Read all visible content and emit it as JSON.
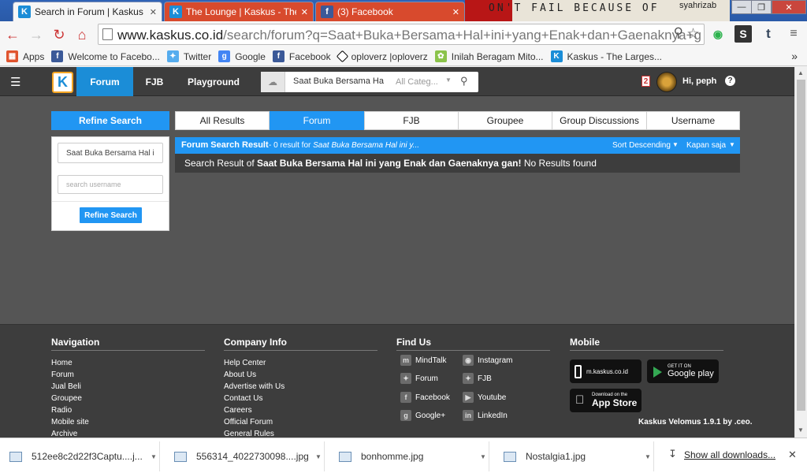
{
  "browser": {
    "tabs": [
      {
        "label": "Search in Forum | Kaskus",
        "close": "✕",
        "fav": "K",
        "fav_color": "#1b8dd7"
      },
      {
        "label": "The Lounge | Kaskus - The",
        "close": "✕",
        "fav": "K",
        "fav_color": "#1b8dd7"
      },
      {
        "label": "(3) Facebook",
        "close": "✕",
        "fav": "f",
        "fav_color": "#3b5998"
      }
    ],
    "wallpaper_text": "ON'T  FAIL  BECAUSE  OF",
    "os_user": "syahrizab",
    "window_buttons": [
      "—",
      "❐",
      "✕"
    ],
    "url_host": "www.kaskus.co.id",
    "url_path": "/search/forum?q=Saat+Buka+Bersama+Hal+ini+yang+Enak+dan+Gaenaknya+g",
    "bookmarks": [
      {
        "label": "Apps",
        "icon": "apps-icon",
        "color": "#e0542e"
      },
      {
        "label": "Welcome to Facebo...",
        "icon": "facebook-icon",
        "color": "#3b5998"
      },
      {
        "label": "Twitter",
        "icon": "twitter-icon",
        "color": "#55acee"
      },
      {
        "label": "Google",
        "icon": "google-icon",
        "color": "#4285f4"
      },
      {
        "label": "Facebook",
        "icon": "facebook-icon",
        "color": "#3b5998"
      },
      {
        "label": "oploverz |oploverz",
        "icon": "oploverz-icon",
        "color": "#ffffff"
      },
      {
        "label": "Inilah Beragam Mito...",
        "icon": "leaf-icon",
        "color": "#8bc34a"
      },
      {
        "label": "Kaskus - The Larges...",
        "icon": "kaskus-icon",
        "color": "#1b8dd7"
      }
    ],
    "bookmarks_more": "»"
  },
  "kaskus": {
    "nav": [
      "Forum",
      "FJB",
      "Playground"
    ],
    "search_query": "Saat Buka Bersama Ha",
    "search_category": "All Categ...",
    "notif_count": "2",
    "greeting": "Hi, peph",
    "help": "?",
    "refine": {
      "title": "Refine Search",
      "keyword_value": "Saat Buka Bersama Hal i",
      "username_placeholder": "search username",
      "button": "Refine Search"
    },
    "result_tabs": [
      "All Results",
      "Forum",
      "FJB",
      "Groupee",
      "Group Discussions",
      "Username"
    ],
    "result_head": {
      "title": "Forum Search Result",
      "count_prefix": " - 0 result for ",
      "count_query": "Saat Buka Bersama Hal ini y...",
      "sort": "Sort Descending",
      "time": "Kapan saja"
    },
    "result_body": {
      "prefix": "Search Result of ",
      "query": "Saat Buka Bersama Hal ini yang Enak dan Gaenaknya gan!",
      "suffix": " No Results found"
    },
    "footer": {
      "navigation": {
        "title": "Navigation",
        "links": [
          "Home",
          "Forum",
          "Jual Beli",
          "Groupee",
          "Radio",
          "Mobile site",
          "Archive"
        ]
      },
      "company": {
        "title": "Company Info",
        "links": [
          "Help Center",
          "About Us",
          "Advertise with Us",
          "Contact Us",
          "Careers",
          "Official Forum",
          "General Rules"
        ]
      },
      "find_us": {
        "title": "Find Us",
        "links": [
          "MindTalk",
          "Instagram",
          "Forum",
          "FJB",
          "Facebook",
          "Youtube",
          "Google+",
          "LinkedIn"
        ]
      },
      "mobile": {
        "title": "Mobile",
        "site": "m.kaskus.co.id",
        "gp_small": "GET IT ON",
        "gp_big": "Google play",
        "as_small": "Download on the",
        "as_big": "App Store"
      },
      "version": "Kaskus Velomus 1.9.1 by .ceo."
    }
  },
  "downloads": {
    "items": [
      "512ee8c2d22f3Captu....j...",
      "556314_4022730098....jpg",
      "bonhomme.jpg",
      "Nostalgia1.jpg"
    ],
    "show_all": "Show all downloads...",
    "close": "✕"
  }
}
